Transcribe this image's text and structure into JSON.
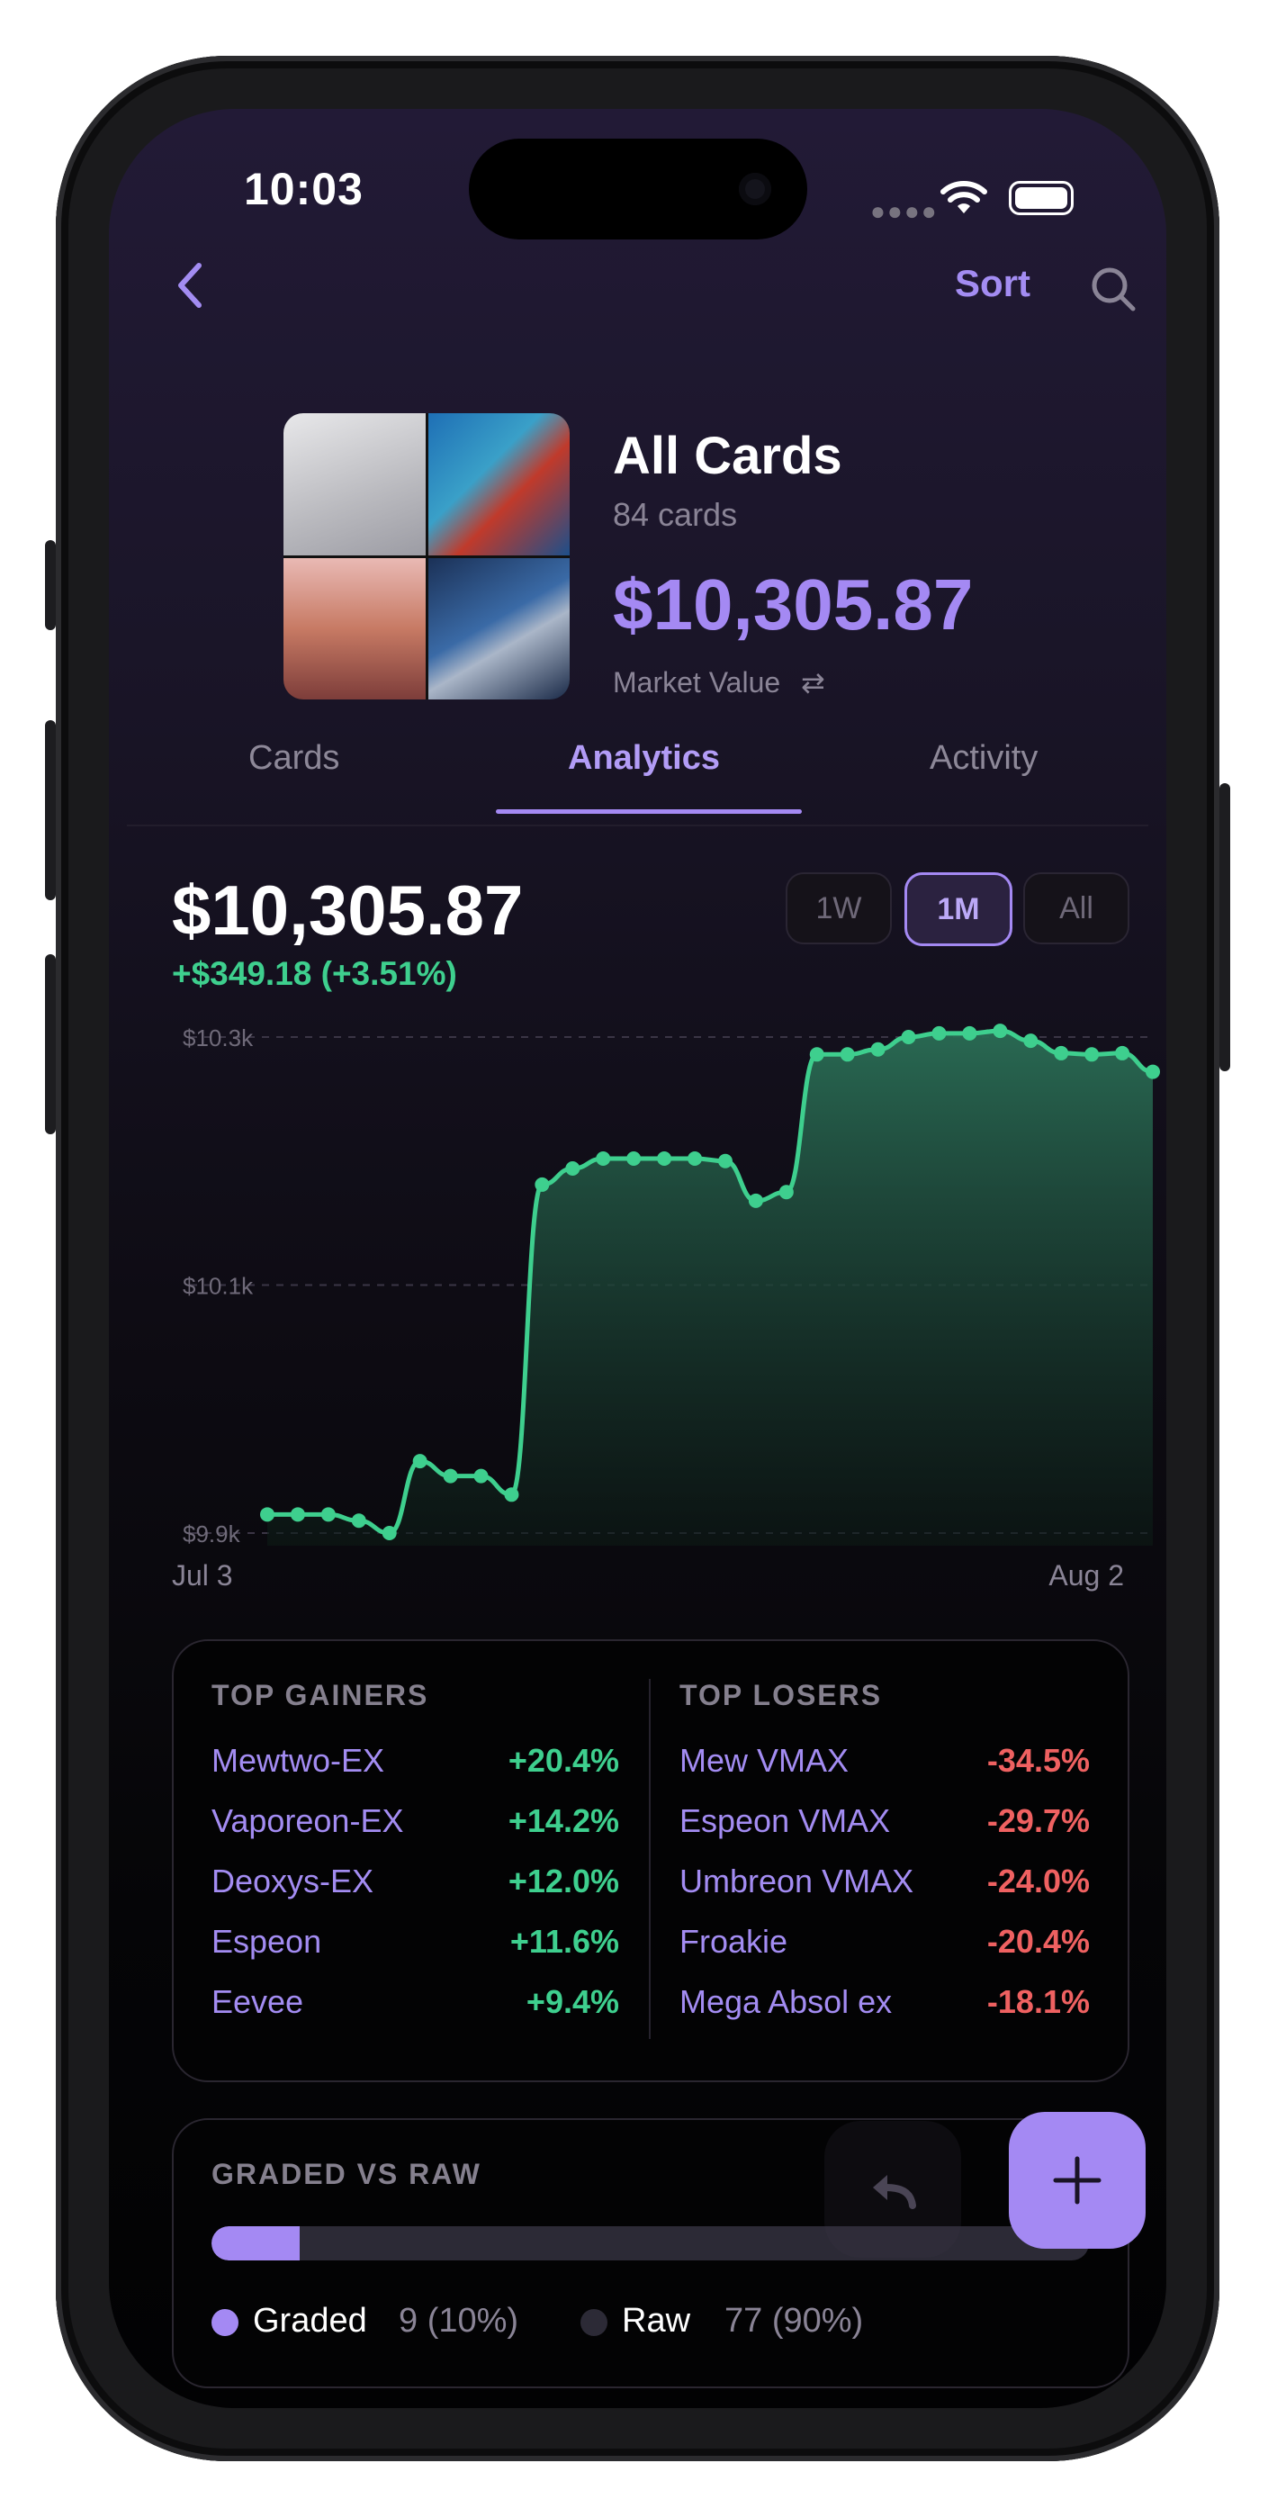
{
  "status_bar": {
    "time": "10:03"
  },
  "nav": {
    "sort_label": "Sort",
    "back_icon": "chevron-left-icon",
    "search_icon": "search-icon"
  },
  "header": {
    "title": "All Cards",
    "subtitle": "84 cards",
    "value": "$10,305.87",
    "value_label": "Market Value",
    "swap_icon": "swap-arrows-icon"
  },
  "tabs": [
    {
      "label": "Cards",
      "active": false
    },
    {
      "label": "Analytics",
      "active": true
    },
    {
      "label": "Activity",
      "active": false
    }
  ],
  "summary": {
    "value": "$10,305.87",
    "change": "+$349.18 (+3.51%)"
  },
  "ranges": [
    {
      "label": "1W",
      "active": false
    },
    {
      "label": "1M",
      "active": true
    },
    {
      "label": "All",
      "active": false
    }
  ],
  "chart_data": {
    "type": "area",
    "y_tick_labels": [
      "$10.3k",
      "$10.1k",
      "$9.9k"
    ],
    "y_ticks": [
      10300,
      10100,
      9900
    ],
    "ylim": [
      9900,
      10300
    ],
    "x_labels": [
      "Jul 3",
      "Aug 2"
    ],
    "values": [
      9915,
      9915,
      9915,
      9910,
      9900,
      9958,
      9946,
      9946,
      9931,
      10181,
      10194,
      10202,
      10202,
      10202,
      10202,
      10200,
      10168,
      10175,
      10286,
      10286,
      10290,
      10300,
      10303,
      10303,
      10305,
      10297,
      10287,
      10286,
      10287,
      10272
    ],
    "line_color": "#3ecf8e",
    "grid": "dashed horizontal"
  },
  "gainers": {
    "title": "TOP GAINERS",
    "items": [
      {
        "name": "Mewtwo-EX",
        "change": "+20.4%"
      },
      {
        "name": "Vaporeon-EX",
        "change": "+14.2%"
      },
      {
        "name": "Deoxys-EX",
        "change": "+12.0%"
      },
      {
        "name": "Espeon",
        "change": "+11.6%"
      },
      {
        "name": "Eevee",
        "change": "+9.4%"
      }
    ]
  },
  "losers": {
    "title": "TOP LOSERS",
    "items": [
      {
        "name": "Mew VMAX",
        "change": "-34.5%"
      },
      {
        "name": "Espeon VMAX",
        "change": "-29.7%"
      },
      {
        "name": "Umbreon VMAX",
        "change": "-24.0%"
      },
      {
        "name": "Froakie",
        "change": "-20.4%"
      },
      {
        "name": "Mega Absol ex",
        "change": "-18.1%"
      }
    ]
  },
  "graded": {
    "title": "GRADED VS RAW",
    "graded_fraction": 0.1,
    "graded_label": "Graded",
    "graded_value": "9 (10%)",
    "raw_label": "Raw",
    "raw_value": "77 (90%)",
    "graded_color": "#a489f3",
    "raw_color": "#2c2a36"
  },
  "fab": {
    "add_icon": "plus-icon",
    "undo_icon": "undo-icon"
  }
}
